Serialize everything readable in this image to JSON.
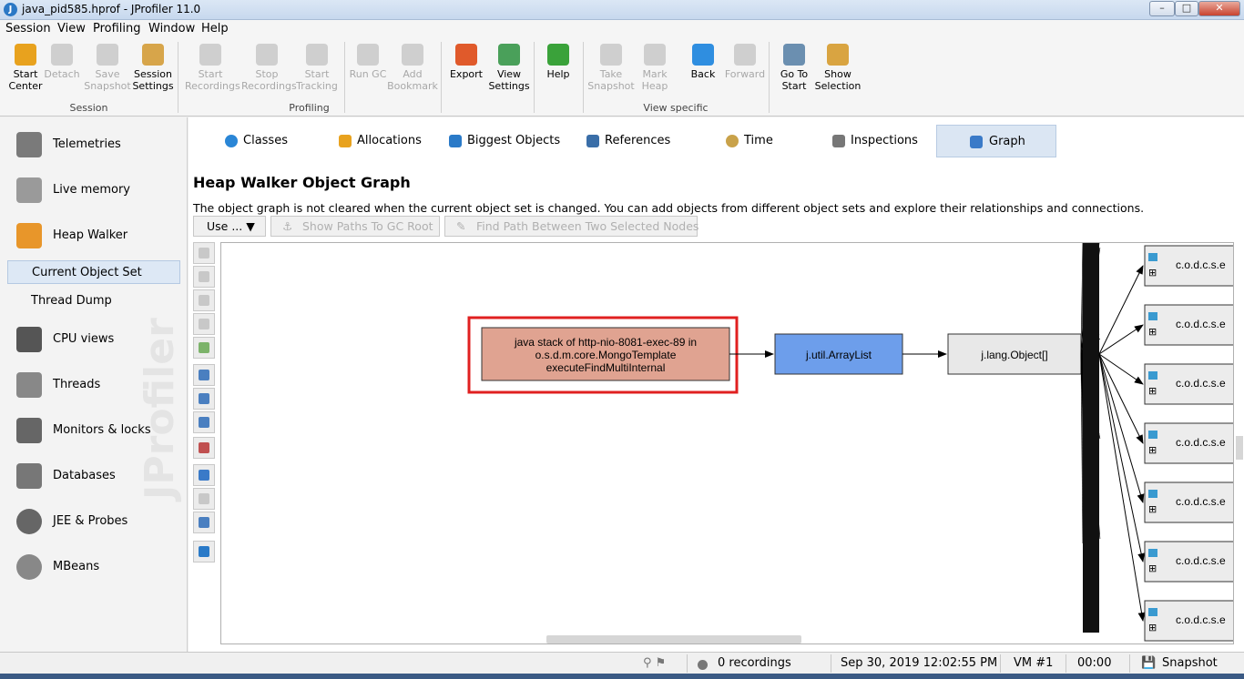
{
  "window": {
    "title": "java_pid585.hprof - JProfiler 11.0"
  },
  "menu": [
    "Session",
    "View",
    "Profiling",
    "Window",
    "Help"
  ],
  "toolbar": {
    "buttons": [
      {
        "line1": "Start",
        "line2": "Center",
        "enabled": true,
        "icon": "start-center-icon",
        "color": "#e8a21e"
      },
      {
        "line1": "Detach",
        "line2": "",
        "enabled": false,
        "icon": "detach-icon",
        "color": "#cfcfcf"
      },
      {
        "line1": "Save",
        "line2": "Snapshot",
        "enabled": false,
        "icon": "save-snapshot-icon",
        "color": "#cfcfcf"
      },
      {
        "line1": "Session",
        "line2": "Settings",
        "enabled": true,
        "icon": "session-settings-icon",
        "color": "#d7a54a"
      },
      {
        "line1": "Start",
        "line2": "Recordings",
        "enabled": false,
        "icon": "start-recordings-icon",
        "color": "#cfcfcf"
      },
      {
        "line1": "Stop",
        "line2": "Recordings",
        "enabled": false,
        "icon": "stop-recordings-icon",
        "color": "#cfcfcf"
      },
      {
        "line1": "Start",
        "line2": "Tracking",
        "enabled": false,
        "icon": "start-tracking-icon",
        "color": "#cfcfcf"
      },
      {
        "line1": "Run GC",
        "line2": "",
        "enabled": false,
        "icon": "run-gc-icon",
        "color": "#cfcfcf"
      },
      {
        "line1": "Add",
        "line2": "Bookmark",
        "enabled": false,
        "icon": "add-bookmark-icon",
        "color": "#cfcfcf"
      },
      {
        "line1": "Export",
        "line2": "",
        "enabled": true,
        "icon": "export-icon",
        "color": "#e05a2b"
      },
      {
        "line1": "View",
        "line2": "Settings",
        "enabled": true,
        "icon": "view-settings-icon",
        "color": "#4aa05a"
      },
      {
        "line1": "Help",
        "line2": "",
        "enabled": true,
        "icon": "help-icon",
        "color": "#3aa23a"
      },
      {
        "line1": "Take",
        "line2": "Snapshot",
        "enabled": false,
        "icon": "take-snapshot-icon",
        "color": "#cfcfcf"
      },
      {
        "line1": "Mark",
        "line2": "Heap",
        "enabled": false,
        "icon": "mark-heap-icon",
        "color": "#cfcfcf"
      },
      {
        "line1": "Back",
        "line2": "",
        "enabled": true,
        "icon": "back-arrow-icon",
        "color": "#2f8ee0"
      },
      {
        "line1": "Forward",
        "line2": "",
        "enabled": false,
        "icon": "forward-arrow-icon",
        "color": "#cfcfcf"
      },
      {
        "line1": "Go To",
        "line2": "Start",
        "enabled": true,
        "icon": "go-to-start-icon",
        "color": "#6b8fb0"
      },
      {
        "line1": "Show",
        "line2": "Selection",
        "enabled": true,
        "icon": "show-selection-icon",
        "color": "#d9a441"
      }
    ],
    "groups": [
      "Session",
      "Profiling",
      "View specific"
    ]
  },
  "sidebar": {
    "items": [
      {
        "label": "Telemetries",
        "icon": "telemetries-icon"
      },
      {
        "label": "Live memory",
        "icon": "live-memory-icon"
      },
      {
        "label": "Heap Walker",
        "icon": "heap-walker-icon"
      },
      {
        "label": "CPU views",
        "icon": "cpu-views-icon"
      },
      {
        "label": "Threads",
        "icon": "threads-icon"
      },
      {
        "label": "Monitors & locks",
        "icon": "monitors-locks-icon"
      },
      {
        "label": "Databases",
        "icon": "databases-icon"
      },
      {
        "label": "JEE & Probes",
        "icon": "jee-probes-icon"
      },
      {
        "label": "MBeans",
        "icon": "mbeans-icon"
      }
    ],
    "subitems": [
      "Current Object Set",
      "Thread Dump"
    ],
    "watermark": "JProfiler"
  },
  "tabs": [
    {
      "label": "Classes",
      "icon": "classes-icon",
      "color": "#2a86d6"
    },
    {
      "label": "Allocations",
      "icon": "allocations-icon",
      "color": "#e8a21e"
    },
    {
      "label": "Biggest Objects",
      "icon": "biggest-objects-icon",
      "color": "#2a7ac8"
    },
    {
      "label": "References",
      "icon": "references-icon",
      "color": "#3a6ea8"
    },
    {
      "label": "Time",
      "icon": "time-icon",
      "color": "#c9a24a"
    },
    {
      "label": "Inspections",
      "icon": "inspections-icon",
      "color": "#777777"
    },
    {
      "label": "Graph",
      "icon": "graph-icon",
      "color": "#3a7ac8"
    }
  ],
  "main": {
    "heading": "Heap Walker Object Graph",
    "description": "The object graph is not cleared when the current object set is changed. You can add objects from different object sets and explore their relationships and connections.",
    "use_button": "Use ... ▼",
    "show_paths": "Show Paths To GC Root",
    "find_path": "Find Path Between Two Selected Nodes"
  },
  "graph": {
    "root": {
      "line1": "java stack of http-nio-8081-exec-89 in",
      "line2": "o.s.d.m.core.MongoTemplate",
      "line3": "executeFindMultiInternal"
    },
    "arraylist": "j.util.ArrayList",
    "objarray": "j.lang.Object[]",
    "children": [
      "c.o.d.c.s.e",
      "c.o.d.c.s.e",
      "c.o.d.c.s.e",
      "c.o.d.c.s.e",
      "c.o.d.c.s.e",
      "c.o.d.c.s.e",
      "c.o.d.c.s.e"
    ],
    "colors": {
      "root_fill": "#e0a391",
      "highlight": "#e02020",
      "arraylist_fill": "#6d9eeb",
      "objarray_fill": "#e8e8e8",
      "child_fill": "#ececec"
    }
  },
  "status": {
    "recordings": "0 recordings",
    "datetime": "Sep 30, 2019 12:02:55 PM",
    "vm": "VM #1",
    "elapsed": "00:00",
    "mode": "Snapshot"
  }
}
